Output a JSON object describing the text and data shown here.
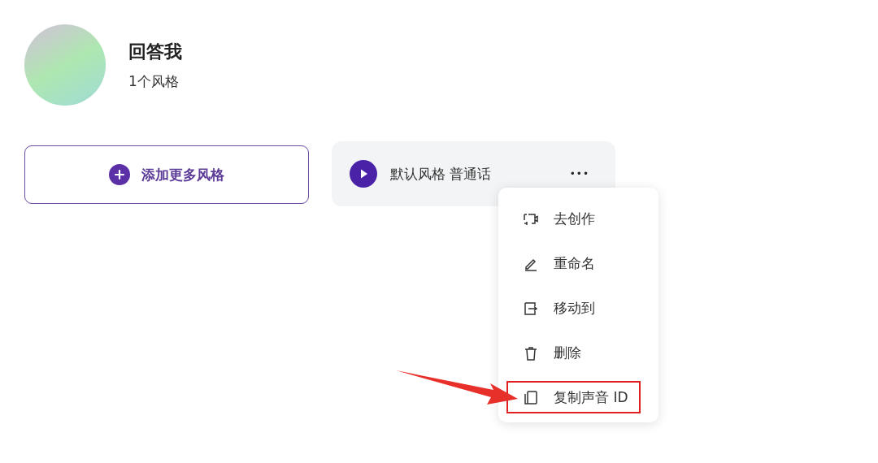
{
  "voice": {
    "name": "回答我",
    "style_count": "1个风格"
  },
  "add_button": {
    "label": "添加更多风格"
  },
  "style_card": {
    "label": "默认风格 普通话",
    "more": "•••"
  },
  "menu": {
    "items": [
      {
        "kind": "create",
        "label": "去创作",
        "annotated": false
      },
      {
        "kind": "rename",
        "label": "重命名",
        "annotated": false
      },
      {
        "kind": "move",
        "label": "移动到",
        "annotated": false
      },
      {
        "kind": "delete",
        "label": "删除",
        "annotated": false
      },
      {
        "kind": "copy",
        "label": "复制声音 ID",
        "annotated": true
      }
    ]
  }
}
